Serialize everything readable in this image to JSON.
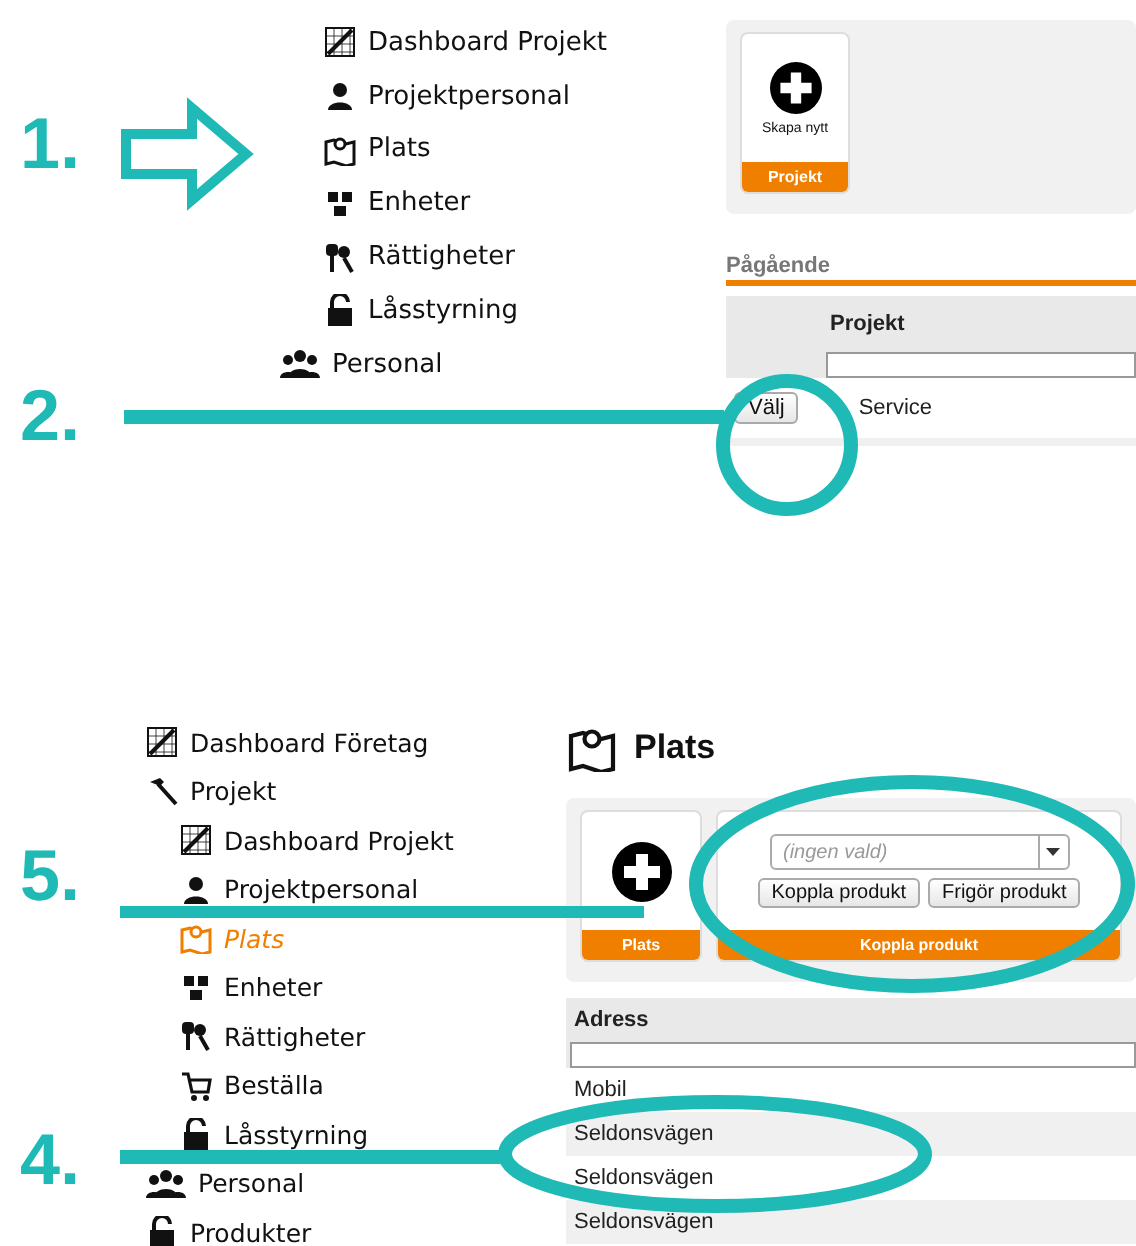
{
  "panels": [
    {
      "sidebar": {
        "children": [
          {
            "label": "Dashboard Projekt",
            "kind": "chart",
            "selected": false
          },
          {
            "label": "Projektpersonal",
            "kind": "person",
            "selected": false
          },
          {
            "label": "Plats",
            "kind": "map",
            "selected": false
          },
          {
            "label": "Enheter",
            "kind": "devices",
            "selected": false
          },
          {
            "label": "Rättigheter",
            "kind": "keys",
            "selected": false
          },
          {
            "label": "Låsstyrning",
            "kind": "lock",
            "selected": false
          }
        ],
        "items": [
          {
            "label": "Personal",
            "kind": "people",
            "selected": false
          }
        ]
      },
      "content": {
        "tiles": [
          {
            "kind": "create",
            "caption": "Skapa nytt",
            "footer": "Projekt"
          }
        ],
        "section_heading": "Pågående",
        "table": {
          "columns": [
            "Projekt"
          ],
          "rows": [
            {
              "button": "Välj",
              "cells": [
                "Service"
              ]
            }
          ]
        }
      }
    },
    {
      "sidebar": {
        "items": [
          {
            "label": "Dashboard Företag",
            "kind": "chart",
            "selected": false
          },
          {
            "label": "Projekt",
            "kind": "hammer",
            "selected": false,
            "children": [
              {
                "label": "Dashboard Projekt",
                "kind": "chart",
                "selected": false
              },
              {
                "label": "Projektpersonal",
                "kind": "person",
                "selected": false
              },
              {
                "label": "Plats",
                "kind": "map",
                "selected": true
              },
              {
                "label": "Enheter",
                "kind": "devices",
                "selected": false
              },
              {
                "label": "Rättigheter",
                "kind": "keys",
                "selected": false
              },
              {
                "label": "Beställa",
                "kind": "cart",
                "selected": false
              },
              {
                "label": "Låsstyrning",
                "kind": "lock",
                "selected": false
              }
            ]
          },
          {
            "label": "Personal",
            "kind": "people",
            "selected": false
          },
          {
            "label": "Produkter",
            "kind": "lock",
            "selected": false
          }
        ]
      },
      "content": {
        "page_title": "Plats",
        "tiles": [
          {
            "kind": "create",
            "footer": "Plats"
          },
          {
            "kind": "connect",
            "select": {
              "placeholder": "(ingen vald)"
            },
            "buttons": [
              "Koppla produkt",
              "Frigör produkt"
            ],
            "footer": "Koppla produkt"
          }
        ],
        "table": {
          "columns": [
            "Adress"
          ],
          "rows": [
            {
              "cells": [
                "Mobil"
              ]
            },
            {
              "cells": [
                "Seldonsvägen"
              ]
            },
            {
              "cells": [
                "Seldonsvägen"
              ]
            },
            {
              "cells": [
                "Seldonsvägen"
              ]
            }
          ]
        }
      }
    }
  ],
  "annotations": [
    {
      "label": "1.",
      "kind": "arrow"
    },
    {
      "label": "2.",
      "kind": "circle"
    },
    {
      "label": "5.",
      "kind": "ellipse"
    },
    {
      "label": "4.",
      "kind": "ellipse"
    }
  ]
}
